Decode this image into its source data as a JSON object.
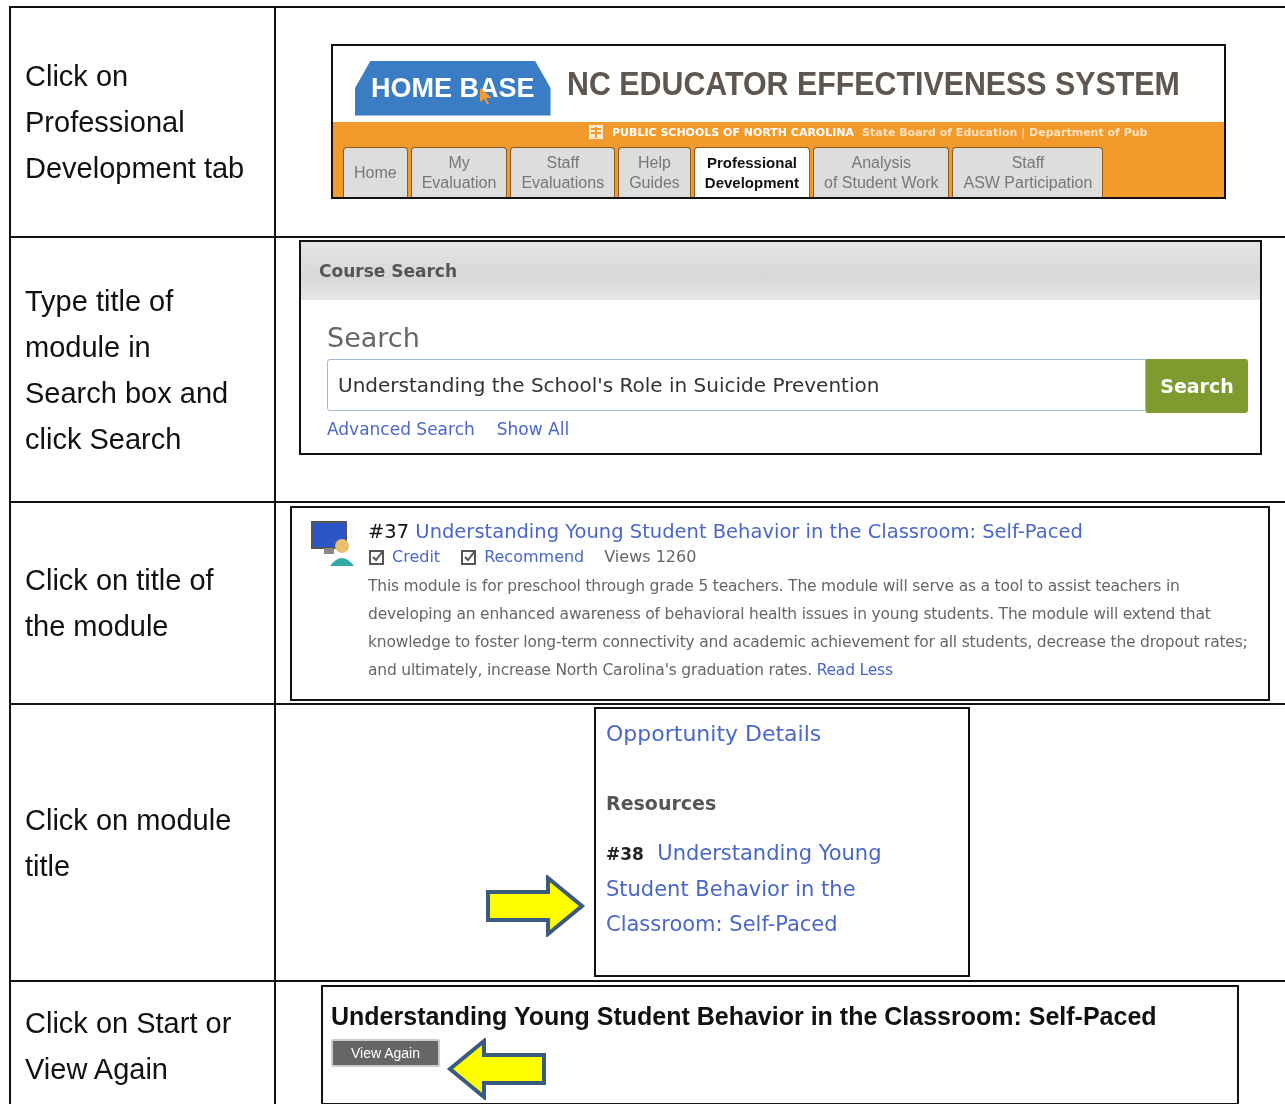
{
  "steps": [
    {
      "instruction": "Click on Professional Development tab",
      "kind": "banner"
    },
    {
      "instruction": "Type title of module in Search box and click Search",
      "kind": "search"
    },
    {
      "instruction": "Click on title of the module",
      "kind": "result"
    },
    {
      "instruction": "Click on module title",
      "kind": "details"
    },
    {
      "instruction": "Click on Start or View Again",
      "kind": "start"
    }
  ],
  "banner": {
    "logo": "HOME BASE",
    "title": "NC EDUCATOR EFFECTIVENESS SYSTEM",
    "agency": "PUBLIC SCHOOLS OF NORTH CAROLINA",
    "agency_sub": "State Board of Education | Department of Pub",
    "tabs": [
      {
        "label": "Home",
        "selected": false
      },
      {
        "label": "My\nEvaluation",
        "selected": false
      },
      {
        "label": "Staff\nEvaluations",
        "selected": false
      },
      {
        "label": "Help\nGuides",
        "selected": false
      },
      {
        "label": "Professional\nDevelopment",
        "selected": true
      },
      {
        "label": "Analysis\nof Student Work",
        "selected": false
      },
      {
        "label": "Staff\nASW Participation",
        "selected": false
      }
    ]
  },
  "course_search": {
    "header": "Course Search",
    "label": "Search",
    "value": "Understanding the School's Role in Suicide Prevention",
    "button": "Search",
    "links": [
      "Advanced Search",
      "Show All"
    ]
  },
  "result": {
    "number": "#37",
    "title": "Understanding Young Student Behavior in the Classroom: Self-Paced",
    "credit": "Credit",
    "recommend": "Recommend",
    "views": "Views 1260",
    "description": "This module is for preschool through grade 5 teachers. The module will serve as a tool to assist teachers in developing an enhanced awareness of behavioral health issues in young students. The module will extend that knowledge to foster long-term connectivity and academic achievement for all students, decrease the dropout rates; and ultimately, increase North Carolina's graduation rates.",
    "read_less": "Read Less"
  },
  "details": {
    "heading": "Opportunity Details",
    "section": "Resources",
    "number": "#38",
    "title": "Understanding Young Student Behavior in the Classroom: Self-Paced"
  },
  "start": {
    "title": "Understanding Young Student Behavior in the Classroom: Self-Paced",
    "button": "View Again"
  }
}
